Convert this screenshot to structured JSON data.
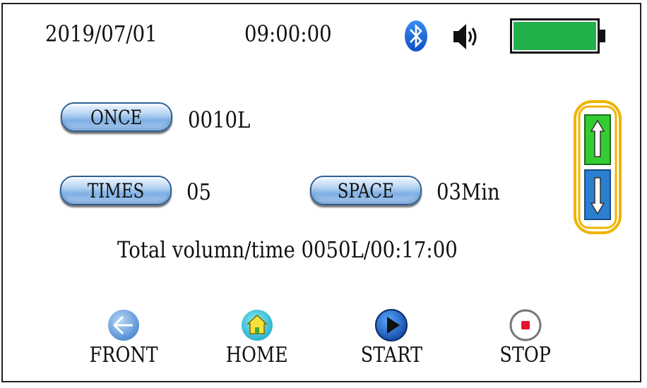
{
  "status_bar": {
    "date": "2019/07/01",
    "time": "09:00:00",
    "bluetooth_icon": "bluetooth-icon",
    "speaker_icon": "speaker-icon",
    "battery_icon": "battery-icon",
    "battery_level": 1.0,
    "battery_color": "#22b04b"
  },
  "settings": {
    "once": {
      "label": "ONCE",
      "value": "0010L"
    },
    "times": {
      "label": "TIMES",
      "value": "05"
    },
    "space": {
      "label": "SPACE",
      "value": "03Min"
    },
    "total": "Total volumn/time 0050L/00:17:00"
  },
  "scroller": {
    "up_icon": "arrow-up-icon",
    "down_icon": "arrow-down-icon",
    "up_color": "#33cc33",
    "down_color": "#2a7fd0",
    "frame_color": "#f0b400"
  },
  "nav": {
    "front": {
      "label": "FRONT",
      "icon": "arrow-left-icon"
    },
    "home": {
      "label": "HOME",
      "icon": "home-icon"
    },
    "start": {
      "label": "START",
      "icon": "play-icon"
    },
    "stop": {
      "label": "STOP",
      "icon": "stop-icon"
    }
  }
}
